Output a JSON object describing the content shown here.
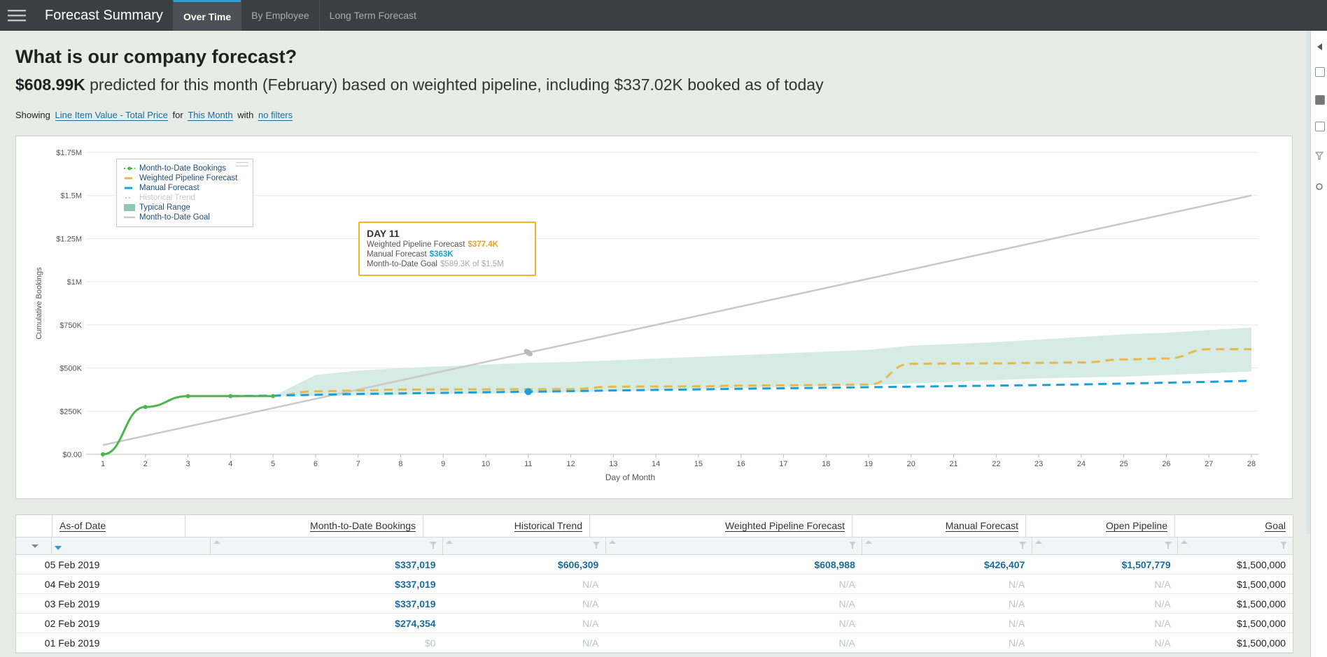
{
  "app": {
    "title": "Forecast Summary",
    "tabs": [
      {
        "label": "Over Time",
        "active": true
      },
      {
        "label": "By Employee",
        "active": false
      },
      {
        "label": "Long Term Forecast",
        "active": false
      }
    ]
  },
  "header": {
    "question": "What is our company forecast?",
    "summary_amount": "$608.99K",
    "summary_text": "predicted for this month (February) based on weighted pipeline, including $337.02K booked as of today"
  },
  "filters": {
    "showing_label": "Showing",
    "measure": "Line Item Value - Total Price",
    "for_label": "for",
    "period": "This Month",
    "with_label": "with",
    "filters": "no filters"
  },
  "tooltip": {
    "title": "DAY 11",
    "weighted_label": "Weighted Pipeline Forecast",
    "weighted_value": "$377.4K",
    "manual_label": "Manual Forecast",
    "manual_value": "$363K",
    "goal_label": "Month-to-Date Goal",
    "goal_value": "$589.3K of $1.5M"
  },
  "legend": {
    "items": [
      "Month-to-Date Bookings",
      "Weighted Pipeline Forecast",
      "Manual Forecast",
      "Historical Trend",
      "Typical Range",
      "Month-to-Date Goal"
    ]
  },
  "colors": {
    "bookings": "#4cb64a",
    "weighted": "#e8b84a",
    "manual": "#1aa0d8",
    "goal": "#c9c9c9",
    "range": "#d5ebe3",
    "link": "#1a6b9c"
  },
  "chart_data": {
    "type": "line",
    "xlabel": "Day of Month",
    "ylabel": "Cumulative Bookings",
    "x": [
      1,
      2,
      3,
      4,
      5,
      6,
      7,
      8,
      9,
      10,
      11,
      12,
      13,
      14,
      15,
      16,
      17,
      18,
      19,
      20,
      21,
      22,
      23,
      24,
      25,
      26,
      27,
      28
    ],
    "ylim": [
      0,
      1750000
    ],
    "yticks": [
      0,
      250000,
      500000,
      750000,
      1000000,
      1250000,
      1500000,
      1750000
    ],
    "ytick_labels": [
      "$0.00",
      "$250K",
      "$500K",
      "$750K",
      "$1M",
      "$1.25M",
      "$1.5M",
      "$1.75M"
    ],
    "series": [
      {
        "name": "Month-to-Date Bookings",
        "x": [
          1,
          2,
          3,
          4,
          5
        ],
        "values": [
          0,
          274354,
          337019,
          337019,
          337019
        ]
      },
      {
        "name": "Weighted Pipeline Forecast",
        "x": [
          4,
          5,
          6,
          7,
          8,
          9,
          10,
          11,
          12,
          13,
          14,
          15,
          16,
          17,
          18,
          19,
          20,
          21,
          22,
          23,
          24,
          25,
          26,
          27,
          28
        ],
        "values": [
          337019,
          340000,
          365000,
          370000,
          375000,
          376000,
          376500,
          377400,
          378000,
          392000,
          393000,
          394000,
          398000,
          400000,
          402000,
          404000,
          525000,
          526000,
          527000,
          530000,
          532000,
          550000,
          555000,
          609000,
          608988
        ]
      },
      {
        "name": "Manual Forecast",
        "x": [
          4,
          5,
          6,
          7,
          8,
          9,
          10,
          11,
          12,
          13,
          14,
          15,
          16,
          17,
          18,
          19,
          20,
          21,
          22,
          23,
          24,
          25,
          26,
          27,
          28
        ],
        "values": [
          337019,
          340000,
          345000,
          350000,
          353000,
          356000,
          360000,
          363000,
          366000,
          370000,
          373000,
          376000,
          380000,
          383000,
          386000,
          389000,
          392000,
          395000,
          398000,
          401000,
          405000,
          410000,
          415000,
          420000,
          426407
        ]
      },
      {
        "name": "Typical Range",
        "x": [
          5,
          6,
          7,
          8,
          9,
          10,
          11,
          12,
          13,
          14,
          15,
          16,
          17,
          18,
          19,
          20,
          21,
          22,
          23,
          24,
          25,
          26,
          27,
          28
        ],
        "low": [
          337019,
          337019,
          340000,
          345000,
          350000,
          352000,
          355000,
          360000,
          365000,
          370000,
          380000,
          385000,
          390000,
          395000,
          400000,
          410000,
          420000,
          430000,
          440000,
          445000,
          450000,
          460000,
          470000,
          480000
        ],
        "high": [
          337019,
          460000,
          485000,
          500000,
          510000,
          520000,
          530000,
          535000,
          545000,
          555000,
          565000,
          575000,
          585000,
          595000,
          605000,
          630000,
          640000,
          650000,
          665000,
          680000,
          695000,
          705000,
          720000,
          735000
        ]
      },
      {
        "name": "Month-to-Date Goal",
        "x": [
          1,
          28
        ],
        "values": [
          53571,
          1500000
        ]
      }
    ],
    "highlight": {
      "day": 11,
      "weighted": 377400,
      "manual": 363000,
      "goal": 589300
    }
  },
  "table": {
    "columns": [
      "As-of Date",
      "Month-to-Date Bookings",
      "Historical Trend",
      "Weighted Pipeline Forecast",
      "Manual Forecast",
      "Open Pipeline",
      "Goal"
    ],
    "rows": [
      [
        "05 Feb 2019",
        "$337,019",
        "$606,309",
        "$608,988",
        "$426,407",
        "$1,507,779",
        "$1,500,000"
      ],
      [
        "04 Feb 2019",
        "$337,019",
        "N/A",
        "N/A",
        "N/A",
        "N/A",
        "$1,500,000"
      ],
      [
        "03 Feb 2019",
        "$337,019",
        "N/A",
        "N/A",
        "N/A",
        "N/A",
        "$1,500,000"
      ],
      [
        "02 Feb 2019",
        "$274,354",
        "N/A",
        "N/A",
        "N/A",
        "N/A",
        "$1,500,000"
      ],
      [
        "01 Feb 2019",
        "$0",
        "N/A",
        "N/A",
        "N/A",
        "N/A",
        "$1,500,000"
      ]
    ]
  }
}
